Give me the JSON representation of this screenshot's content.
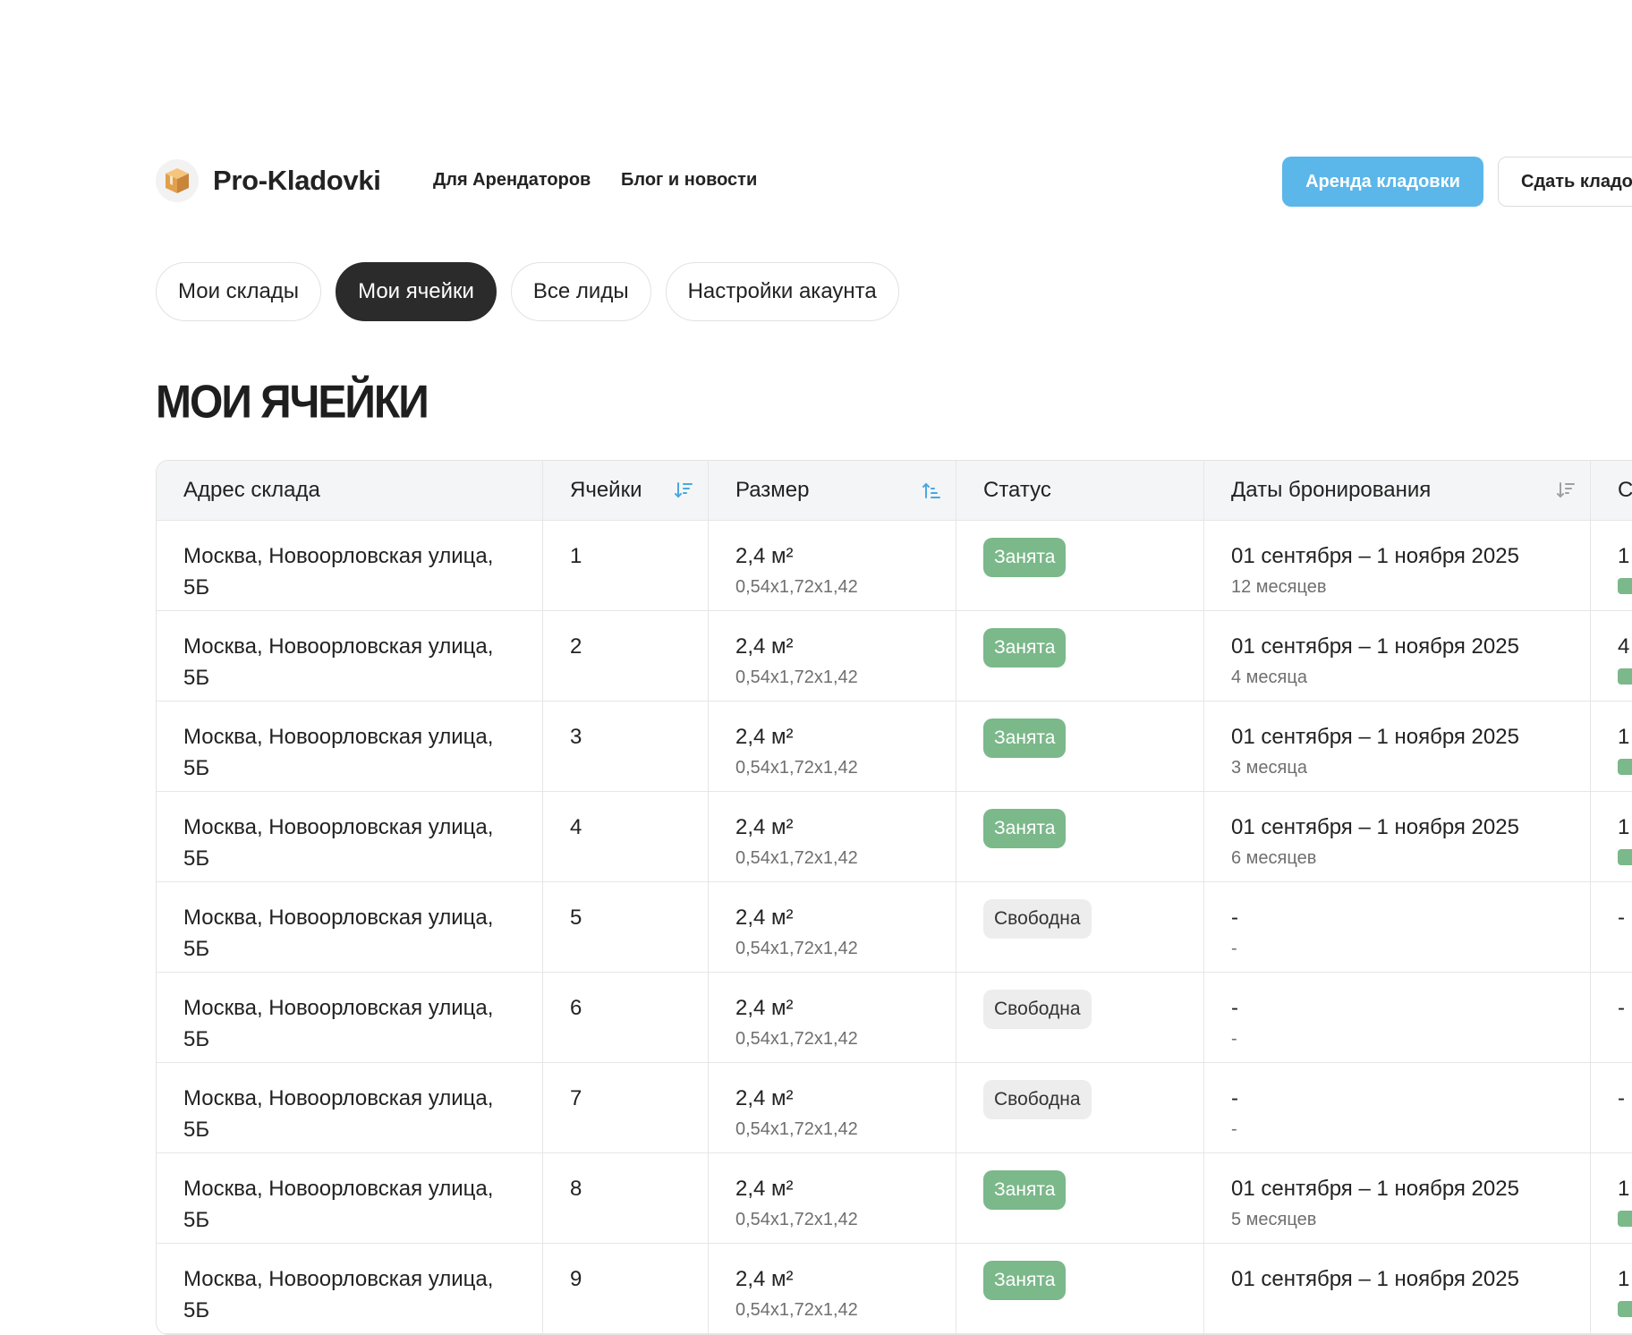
{
  "header": {
    "logo_text": "Pro-Kladovki",
    "nav": [
      "Для Арендаторов",
      "Блог и новости"
    ],
    "rent_button": "Аренда кладовки",
    "lease_button": "Сдать кладовку"
  },
  "tabs": [
    {
      "label": "Мои склады",
      "active": false
    },
    {
      "label": "Мои ячейки",
      "active": true
    },
    {
      "label": "Все лиды",
      "active": false
    },
    {
      "label": "Настройки акаунта",
      "active": false
    }
  ],
  "page_title": "МОИ ЯЧЕЙКИ",
  "table": {
    "headers": [
      "Адрес склада",
      "Ячейки",
      "Размер",
      "Статус",
      "Даты бронирования",
      "С"
    ],
    "rows": [
      {
        "address1": "Москва, Новоорловская улица,",
        "address2": "5Б",
        "cell": "1",
        "area": "2,4 м²",
        "dims": "0,54x1,72x1,42",
        "status": "Занята",
        "busy": true,
        "dates": "01 сентября – 1 ноября 2025",
        "duration": "12 месяцев",
        "edge": "1"
      },
      {
        "address1": "Москва, Новоорловская улица,",
        "address2": "5Б",
        "cell": "2",
        "area": "2,4 м²",
        "dims": "0,54x1,72x1,42",
        "status": "Занята",
        "busy": true,
        "dates": "01 сентября – 1 ноября 2025",
        "duration": "4 месяца",
        "edge": "4"
      },
      {
        "address1": "Москва, Новоорловская улица,",
        "address2": "5Б",
        "cell": "3",
        "area": "2,4 м²",
        "dims": "0,54x1,72x1,42",
        "status": "Занята",
        "busy": true,
        "dates": "01 сентября – 1 ноября 2025",
        "duration": "3 месяца",
        "edge": "1"
      },
      {
        "address1": "Москва, Новоорловская улица,",
        "address2": "5Б",
        "cell": "4",
        "area": "2,4 м²",
        "dims": "0,54x1,72x1,42",
        "status": "Занята",
        "busy": true,
        "dates": "01 сентября – 1 ноября 2025",
        "duration": "6 месяцев",
        "edge": "1"
      },
      {
        "address1": "Москва, Новоорловская улица,",
        "address2": "5Б",
        "cell": "5",
        "area": "2,4 м²",
        "dims": "0,54x1,72x1,42",
        "status": "Свободна",
        "busy": false,
        "dates": "-",
        "duration": "-",
        "edge": "-"
      },
      {
        "address1": "Москва, Новоорловская улица,",
        "address2": "5Б",
        "cell": "6",
        "area": "2,4 м²",
        "dims": "0,54x1,72x1,42",
        "status": "Свободна",
        "busy": false,
        "dates": "-",
        "duration": "-",
        "edge": "-"
      },
      {
        "address1": "Москва, Новоорловская улица,",
        "address2": "5Б",
        "cell": "7",
        "area": "2,4 м²",
        "dims": "0,54x1,72x1,42",
        "status": "Свободна",
        "busy": false,
        "dates": "-",
        "duration": "-",
        "edge": "-"
      },
      {
        "address1": "Москва, Новоорловская улица,",
        "address2": "5Б",
        "cell": "8",
        "area": "2,4 м²",
        "dims": "0,54x1,72x1,42",
        "status": "Занята",
        "busy": true,
        "dates": "01 сентября – 1 ноября 2025",
        "duration": "5 месяцев",
        "edge": "1"
      },
      {
        "address1": "Москва, Новоорловская улица,",
        "address2": "5Б",
        "cell": "9",
        "area": "2,4 м²",
        "dims": "0,54x1,72x1,42",
        "status": "Занята",
        "busy": true,
        "dates": "01 сентября – 1 ноября 2025",
        "duration": "",
        "edge": "1"
      }
    ]
  },
  "colors": {
    "accent": "#5bb6ea",
    "busy": "#7bb88a",
    "free": "#ededed",
    "dark": "#2b2b2b"
  },
  "icons": {
    "logo": "box-icon",
    "sort": "sort-icon"
  }
}
